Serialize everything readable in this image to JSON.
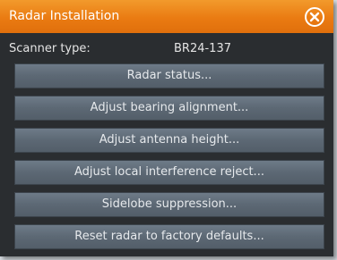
{
  "dialog": {
    "title": "Radar Installation",
    "close_icon": "close-circle-icon"
  },
  "scanner": {
    "label": "Scanner type:",
    "value": "BR24-137"
  },
  "buttons": [
    {
      "label": "Radar status..."
    },
    {
      "label": "Adjust bearing alignment..."
    },
    {
      "label": "Adjust antenna height..."
    },
    {
      "label": "Adjust local interference reject..."
    },
    {
      "label": "Sidelobe suppression..."
    },
    {
      "label": "Reset radar to factory defaults..."
    }
  ],
  "colors": {
    "titlebar": "#ea7b12",
    "dialog_bg": "#2a2d30",
    "button_bg": "#5c6874",
    "text": "#e6e9ec"
  }
}
